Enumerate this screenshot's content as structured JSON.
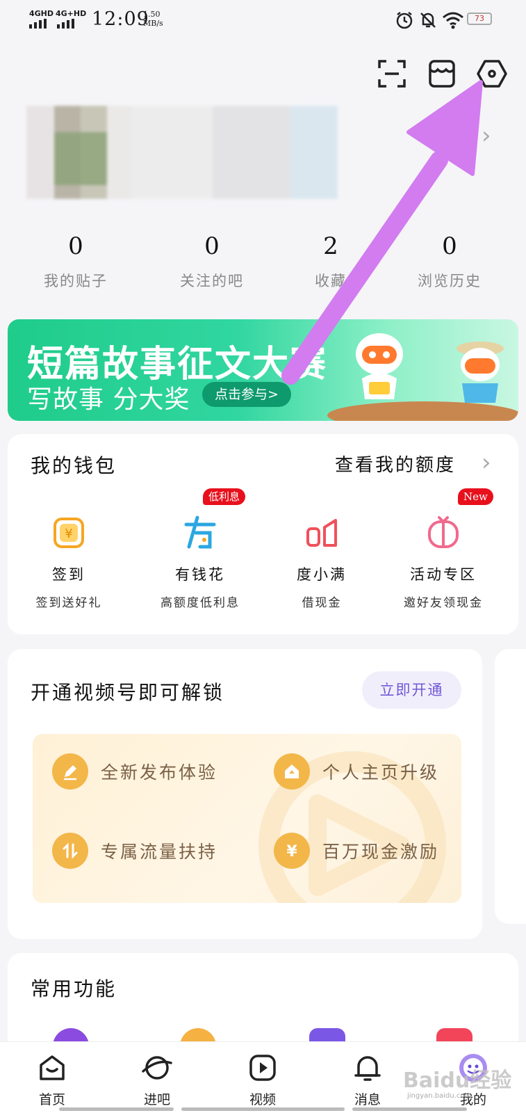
{
  "status_bar": {
    "sig1": "4GHD",
    "sig2": "4G+HD",
    "time": "12:09",
    "speed_value": "1.50",
    "speed_unit": "MB/s",
    "battery": "73"
  },
  "profile": {
    "stats": [
      {
        "value": "0",
        "label": "我的贴子"
      },
      {
        "value": "0",
        "label": "关注的吧"
      },
      {
        "value": "2",
        "label": "收藏"
      },
      {
        "value": "0",
        "label": "浏览历史"
      }
    ]
  },
  "banner": {
    "title": "短篇故事征文大赛",
    "subtitle": "写故事 分大奖",
    "cta": "点击参与>"
  },
  "wallet": {
    "title": "我的钱包",
    "link": "查看我的额度",
    "items": [
      {
        "icon": "yen-square-icon",
        "name": "签到",
        "sub": "签到送好礼",
        "badge": ""
      },
      {
        "icon": "youqianhua-icon",
        "name": "有钱花",
        "sub": "高额度低利息",
        "badge": "低利息"
      },
      {
        "icon": "duxiaoman-icon",
        "name": "度小满",
        "sub": "借现金",
        "badge": ""
      },
      {
        "icon": "activity-icon",
        "name": "活动专区",
        "sub": "邀好友领现金",
        "badge": "New"
      }
    ]
  },
  "video_unlock": {
    "title": "开通视频号即可解锁",
    "button": "立即开通",
    "perks": [
      {
        "icon": "pencil-icon",
        "label": "全新发布体验"
      },
      {
        "icon": "home-upgrade-icon",
        "label": "个人主页升级"
      },
      {
        "icon": "traffic-icon",
        "label": "专属流量扶持"
      },
      {
        "icon": "yen-icon",
        "label": "百万现金激励"
      }
    ]
  },
  "common": {
    "title": "常用功能"
  },
  "nav": {
    "items": [
      {
        "icon": "home-icon",
        "label": "首页"
      },
      {
        "icon": "planet-icon",
        "label": "进吧"
      },
      {
        "icon": "video-icon",
        "label": "视频"
      },
      {
        "icon": "bell-icon",
        "label": "消息"
      },
      {
        "icon": "avatar-icon",
        "label": "我的"
      }
    ]
  },
  "watermark": {
    "text": "Baidu经验",
    "url": "jingyan.baidu.com"
  },
  "colors": {
    "accent_purple": "#7158d6",
    "arrow": "#d27cf0",
    "badge_red": "#e8101d",
    "wallet_orange": "#f5a623",
    "wallet_blue": "#2ba7e0",
    "wallet_red": "#f0515b",
    "wallet_pink": "#f06a8d",
    "banner_green": "#1fcc8a"
  }
}
